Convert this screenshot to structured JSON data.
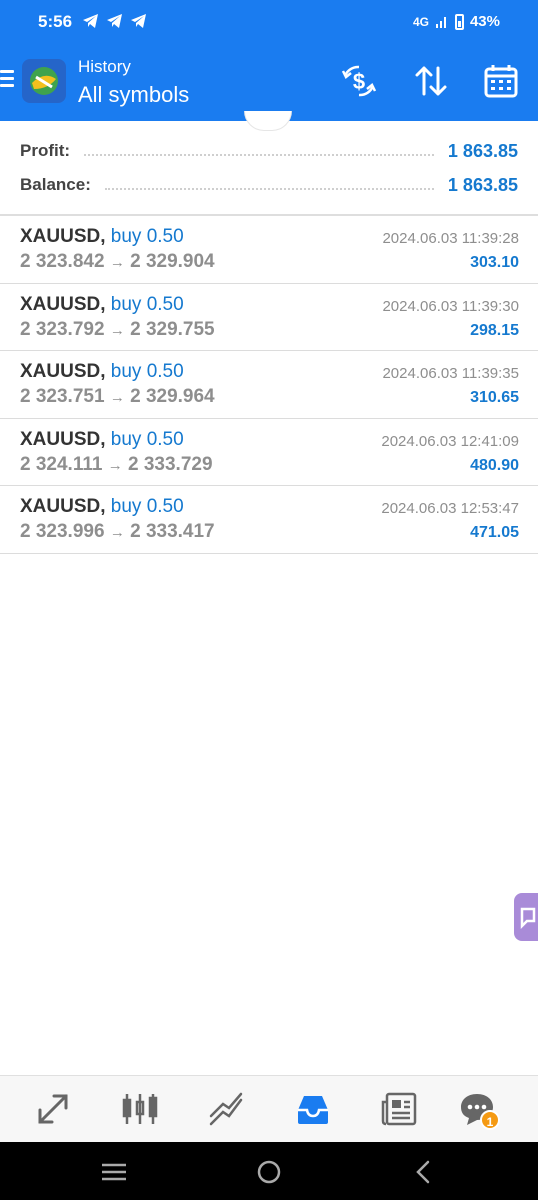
{
  "status_bar": {
    "time": "5:56",
    "network": "4G",
    "battery": "43%"
  },
  "header": {
    "subtitle": "History",
    "title": "All symbols",
    "icons": [
      "menu-icon",
      "app-logo",
      "deposit-dollar-icon",
      "sort-icon",
      "calendar-icon"
    ]
  },
  "summary": {
    "profit_label": "Profit:",
    "profit_value": "1 863.85",
    "balance_label": "Balance:",
    "balance_value": "1 863.85"
  },
  "trades": [
    {
      "symbol": "XAUUSD,",
      "side": "buy 0.50",
      "open": "2 323.842",
      "close": "2 329.904",
      "arrow": "→",
      "time": "2024.06.03 11:39:28",
      "profit": "303.10"
    },
    {
      "symbol": "XAUUSD,",
      "side": "buy 0.50",
      "open": "2 323.792",
      "close": "2 329.755",
      "arrow": "→",
      "time": "2024.06.03 11:39:30",
      "profit": "298.15"
    },
    {
      "symbol": "XAUUSD,",
      "side": "buy 0.50",
      "open": "2 323.751",
      "close": "2 329.964",
      "arrow": "→",
      "time": "2024.06.03 11:39:35",
      "profit": "310.65"
    },
    {
      "symbol": "XAUUSD,",
      "side": "buy 0.50",
      "open": "2 324.111",
      "close": "2 333.729",
      "arrow": "→",
      "time": "2024.06.03 12:41:09",
      "profit": "480.90"
    },
    {
      "symbol": "XAUUSD,",
      "side": "buy 0.50",
      "open": "2 323.996",
      "close": "2 333.417",
      "arrow": "→",
      "time": "2024.06.03 12:53:47",
      "profit": "471.05"
    }
  ],
  "bottom_nav": {
    "items": [
      "quotes-icon",
      "chart-icon",
      "trade-icon",
      "history-icon",
      "news-icon",
      "chat-icon"
    ],
    "active": "history-icon",
    "chat_badge": "1"
  },
  "colors": {
    "accent": "#1a7cf0",
    "value_blue": "#1579cf",
    "badge": "#f59a13"
  }
}
